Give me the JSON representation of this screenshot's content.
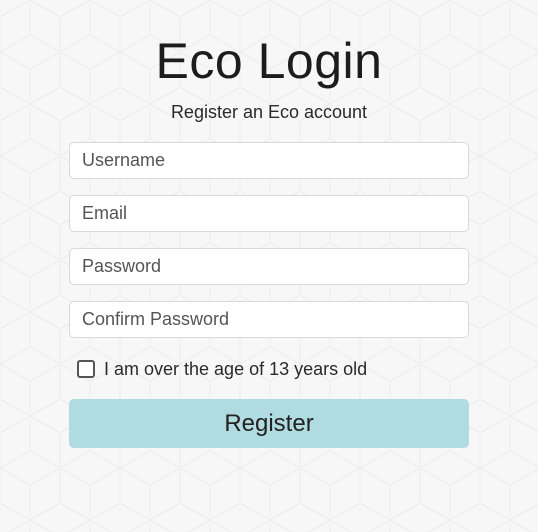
{
  "colors": {
    "background": "#f7f7f7",
    "button_background": "#b0dbe0",
    "field_border": "#d9d9d9"
  },
  "header": {
    "title": "Eco Login",
    "subtitle": "Register an Eco account"
  },
  "form": {
    "username_placeholder": "Username",
    "email_placeholder": "Email",
    "password_placeholder": "Password",
    "confirm_password_placeholder": "Confirm Password",
    "age_checkbox_label": "I am over the age of 13 years old",
    "age_checkbox_checked": false,
    "register_label": "Register"
  }
}
